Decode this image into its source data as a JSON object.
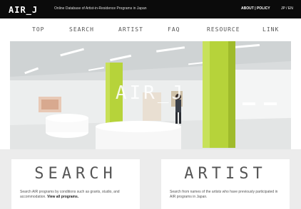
{
  "header": {
    "logo": "AIR_J",
    "tagline": "Online Database of Artist-in-Residence Programs in Japan",
    "about_link": "ABOUT",
    "separator": "|",
    "policy_link": "POLICY",
    "language": "JP / EN"
  },
  "nav": {
    "items": [
      "TOP",
      "SEARCH",
      "ARTIST",
      "FAQ",
      "RESOURCE",
      "LINK"
    ]
  },
  "hero": {
    "overlay_title": "AIR_J"
  },
  "cards": {
    "search": {
      "title": "SEARCH",
      "desc": "Search AIR programs by conditions such as grants, studio, and accommodation.",
      "link": "View all programs."
    },
    "artist": {
      "title": "ARTIST",
      "desc": "Search from names of the artists who have previously participated in AIR programs in Japan."
    }
  },
  "colors": {
    "topbar": "#0b0b0b",
    "pillar": "#b6d33a",
    "panel_bg": "#ececec"
  }
}
